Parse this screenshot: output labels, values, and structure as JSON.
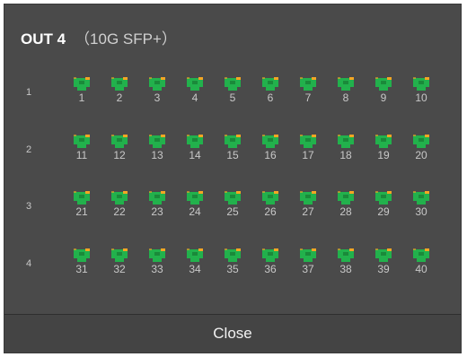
{
  "dialog": {
    "title": "OUT 4",
    "subtitle": "（10G SFP+）"
  },
  "rows": [
    {
      "label": "1",
      "ports": [
        "1",
        "2",
        "3",
        "4",
        "5",
        "6",
        "7",
        "8",
        "9",
        "10"
      ]
    },
    {
      "label": "2",
      "ports": [
        "11",
        "12",
        "13",
        "14",
        "15",
        "16",
        "17",
        "18",
        "19",
        "20"
      ]
    },
    {
      "label": "3",
      "ports": [
        "21",
        "22",
        "23",
        "24",
        "25",
        "26",
        "27",
        "28",
        "29",
        "30"
      ]
    },
    {
      "label": "4",
      "ports": [
        "31",
        "32",
        "33",
        "34",
        "35",
        "36",
        "37",
        "38",
        "39",
        "40"
      ]
    }
  ],
  "port_icon": "sfp-port-icon",
  "colors": {
    "port_body": "#22b14c",
    "port_accent": "#f5a623",
    "background": "#4a4a4a"
  },
  "footer": {
    "close_label": "Close"
  }
}
